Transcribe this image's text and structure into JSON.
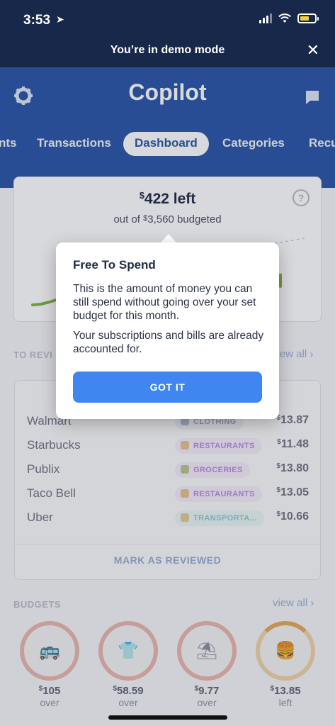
{
  "status_bar": {
    "time": "3:53",
    "battery_color": "#f2cf3c"
  },
  "demo_banner": {
    "text": "You’re in demo mode",
    "close": "✕"
  },
  "header": {
    "title": "Copilot",
    "tabs": [
      "nts",
      "Transactions",
      "Dashboard",
      "Categories",
      "Recu"
    ],
    "active_tab": "Dashboard"
  },
  "summary": {
    "currency": "$",
    "left_amount": "422 left",
    "budget_prefix": "out of ",
    "budget_amount": "3,560 budgeted",
    "help": "?"
  },
  "popup": {
    "title": "Free To Spend",
    "body1": "This is the amount of money you can still spend without going over your set budget for this month.",
    "body2": "Your subscriptions and bills are already accounted for.",
    "button": "GOT IT"
  },
  "to_review": {
    "label": "TO REVI",
    "view_all": "view all ›"
  },
  "transactions": [
    {
      "name": "Walmart",
      "category": "CLOTHING",
      "amount": "13.87",
      "color": "#8e98ab"
    },
    {
      "name": "Starbucks",
      "category": "RESTAURANTS",
      "amount": "11.48",
      "color": "#b78be0"
    },
    {
      "name": "Publix",
      "category": "GROCERIES",
      "amount": "13.80",
      "color": "#b78be0"
    },
    {
      "name": "Taco Bell",
      "category": "RESTAURANTS",
      "amount": "13.05",
      "color": "#b78be0"
    },
    {
      "name": "Uber",
      "category": "TRANSPORTA...",
      "amount": "10.66",
      "color": "#8fc9cc"
    }
  ],
  "mark_reviewed": "MARK AS REVIEWED",
  "budgets": {
    "label": "BUDGETS",
    "view_all": "view all ›",
    "items": [
      {
        "icon": "bus-icon",
        "amount": "105",
        "status": "over",
        "progress": 1.0
      },
      {
        "icon": "shirt-icon",
        "amount": "58.59",
        "status": "over",
        "progress": 1.0
      },
      {
        "icon": "beach-icon",
        "amount": "9.77",
        "status": "over",
        "progress": 1.0
      },
      {
        "icon": "burger-icon",
        "amount": "13.85",
        "status": "left",
        "progress": 0.75
      }
    ]
  },
  "colors": {
    "navy": "#17284a",
    "blue": "#2a55a8",
    "button": "#3f86f0",
    "line_green": "#7cb342"
  }
}
